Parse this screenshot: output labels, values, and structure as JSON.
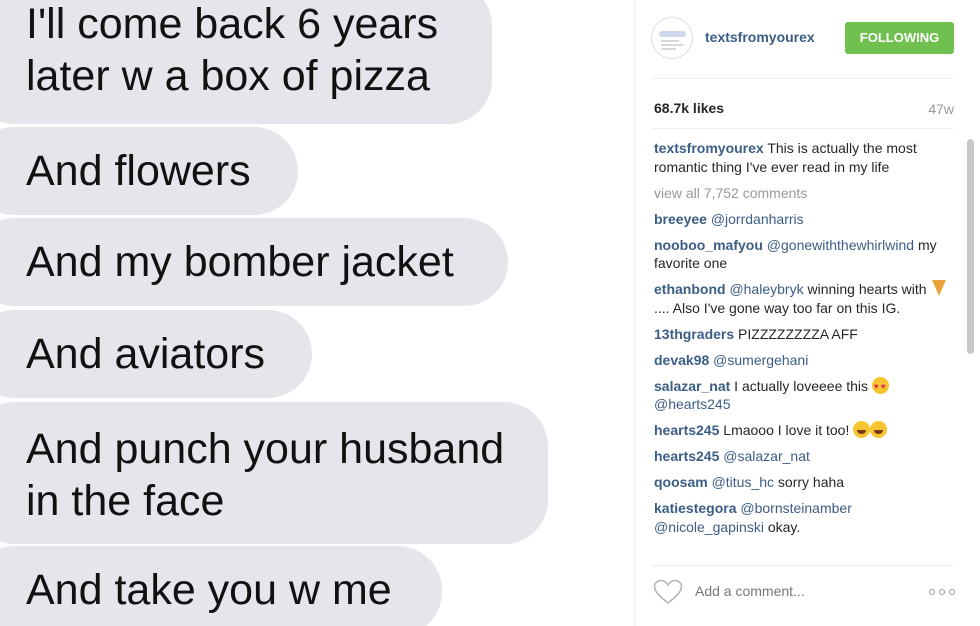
{
  "photo": {
    "messages": [
      "I'll come back 6 years\nlater w a box of pizza",
      "And flowers",
      "And my bomber jacket",
      "And aviators",
      "And punch your husband\nin the face",
      "And take you w me"
    ]
  },
  "header": {
    "username": "textsfromyourex",
    "follow_label": "FOLLOWING"
  },
  "stats": {
    "likes": "68.7k likes",
    "age": "47w"
  },
  "caption": {
    "user": "textsfromyourex",
    "text": " This is actually the most romantic thing I've ever read in my life"
  },
  "view_all": "view all 7,752 comments",
  "comments": [
    {
      "user": "breeyee",
      "mention": "@jorrdanharris",
      "text": ""
    },
    {
      "user": "nooboo_mafyou",
      "mention": "@gonewiththewhirlwind",
      "text": " my favorite one"
    },
    {
      "user": "ethanbond",
      "mention": "@haleybryk",
      "text": " winning hearts with",
      "text2": ".... Also I've gone way too far on this IG."
    },
    {
      "user": "13thgraders",
      "mention": "",
      "text": " PIZZZZZZZZA AFF"
    },
    {
      "user": "devak98",
      "mention": "@sumergehani",
      "text": ""
    },
    {
      "user": "salazar_nat",
      "mention": "",
      "text": " I actually loveeee this",
      "mention2": "@hearts245"
    },
    {
      "user": "hearts245",
      "mention": "",
      "text": " Lmaooo I love it too!"
    },
    {
      "user": "hearts245",
      "mention": "@salazar_nat",
      "text": ""
    },
    {
      "user": "qoosam",
      "mention": "@titus_hc",
      "text": " sorry haha"
    },
    {
      "user": "katiestegora",
      "mention": "@bornsteinamber",
      "mention2": "@nicole_gapinski",
      "text": " okay."
    }
  ],
  "add_comment": {
    "placeholder": "Add a comment..."
  },
  "icons": {
    "like": "heart-outline-icon",
    "more": "more-options-icon"
  },
  "colors": {
    "bubble": "#e6e5eb",
    "username": "#3b5e86",
    "follow_button": "#70c050"
  }
}
